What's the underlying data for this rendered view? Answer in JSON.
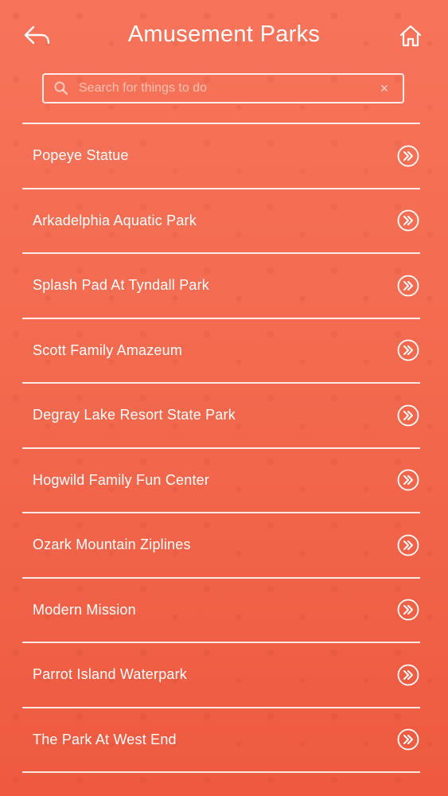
{
  "header": {
    "title": "Amusement Parks",
    "back_icon": "back-arrow-icon",
    "home_icon": "home-icon"
  },
  "search": {
    "placeholder": "Search for things to do",
    "value": "",
    "clear_symbol": "×"
  },
  "list": {
    "items": [
      {
        "label": "Popeye Statue"
      },
      {
        "label": "Arkadelphia Aquatic Park"
      },
      {
        "label": "Splash Pad At Tyndall Park"
      },
      {
        "label": "Scott Family Amazeum"
      },
      {
        "label": "Degray Lake Resort State Park"
      },
      {
        "label": "Hogwild Family Fun Center"
      },
      {
        "label": "Ozark Mountain Ziplines"
      },
      {
        "label": "Modern Mission"
      },
      {
        "label": "Parrot Island Waterpark"
      },
      {
        "label": "The Park At West End"
      }
    ],
    "item_icon": "double-chevron-right-icon"
  },
  "colors": {
    "background_top": "#F7745A",
    "background_bottom": "#EE5A40",
    "foreground": "#FFFFFF"
  }
}
